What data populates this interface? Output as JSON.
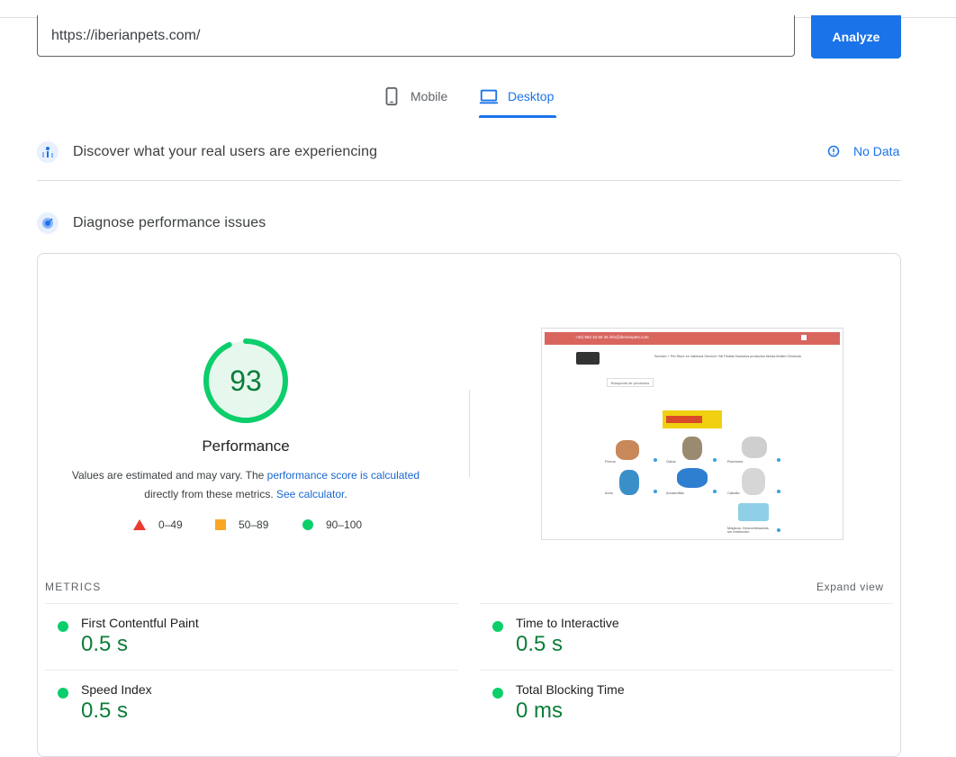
{
  "url_bar": {
    "value": "https://iberianpets.com/",
    "analyze_label": "Analyze"
  },
  "device_tabs": [
    {
      "label": "Mobile",
      "icon": "phone-icon",
      "active": false
    },
    {
      "label": "Desktop",
      "icon": "laptop-icon",
      "active": true
    }
  ],
  "field_data": {
    "title": "Discover what your real users are experiencing",
    "status": "No Data",
    "icon": "crux-icon"
  },
  "lab_data": {
    "title": "Diagnose performance issues",
    "icon": "lighthouse-icon"
  },
  "performance": {
    "score": 93,
    "label": "Performance",
    "desc_prefix": "Values are estimated and may vary. The ",
    "desc_link1": "performance score is calculated",
    "desc_middle": "directly from these metrics. ",
    "desc_link2": "See calculator",
    "desc_suffix": ".",
    "score_color": "#0cce6b"
  },
  "legend": [
    {
      "range": "0–49",
      "shape": "triangle",
      "color": "#eb3a2f"
    },
    {
      "range": "50–89",
      "shape": "square",
      "color": "#f9a825"
    },
    {
      "range": "90–100",
      "shape": "circle",
      "color": "#0cce6b"
    }
  ],
  "preview": {
    "topbar_text": "+34) 963 34 50 46   info@iberianpets.com",
    "nav_text": "Servicio + Pet Store en Valencia    Servicio +Mi Pedido    Nuestros productos tienda    Multim    Gimbook",
    "search_placeholder": "Búsqueda de productos",
    "pets": [
      "Perros",
      "Gatos",
      "Roedores",
      "Aves",
      "Acuariofilia",
      "Caballo",
      "Mágicos: Descontinuados sin restricción"
    ]
  },
  "metrics": {
    "heading": "METRICS",
    "expand_label": "Expand view",
    "items": [
      {
        "name": "First Contentful Paint",
        "value": "0.5 s"
      },
      {
        "name": "Time to Interactive",
        "value": "0.5 s"
      },
      {
        "name": "Speed Index",
        "value": "0.5 s"
      },
      {
        "name": "Total Blocking Time",
        "value": "0 ms"
      }
    ]
  }
}
